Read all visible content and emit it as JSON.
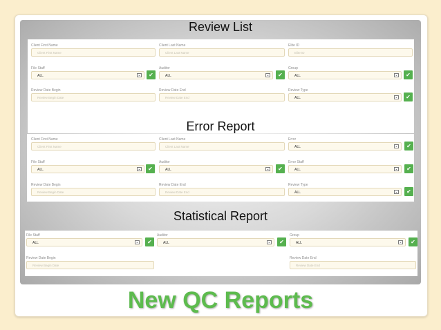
{
  "slide_title": "New QC Reports",
  "review_list": {
    "heading": "Review List",
    "client_first_name": {
      "label": "Client First Name",
      "placeholder": "Client First Name"
    },
    "client_last_name": {
      "label": "Client Last Name",
      "placeholder": "Client Last Name"
    },
    "elite_id": {
      "label": "Elite ID",
      "placeholder": "Elite ID"
    },
    "file_staff": {
      "label": "File Staff",
      "value": "ALL"
    },
    "auditor": {
      "label": "Auditor",
      "value": "ALL"
    },
    "group": {
      "label": "Group",
      "value": "ALL"
    },
    "review_date_begin": {
      "label": "Review Date Begin",
      "placeholder": "Review Begin Date"
    },
    "review_date_end": {
      "label": "Review Date End",
      "placeholder": "Review Date End"
    },
    "review_type": {
      "label": "Review Type",
      "value": "ALL"
    }
  },
  "error_report": {
    "heading": "Error Report",
    "client_first_name": {
      "label": "Client First Name",
      "placeholder": "Client First Name"
    },
    "client_last_name": {
      "label": "Client Last Name",
      "placeholder": "Client Last Name"
    },
    "error": {
      "label": "Error",
      "value": "ALL"
    },
    "file_staff": {
      "label": "File Staff",
      "value": "ALL"
    },
    "auditor": {
      "label": "Auditor",
      "value": "ALL"
    },
    "error_staff": {
      "label": "Error Staff",
      "value": "ALL"
    },
    "review_date_begin": {
      "label": "Review Date Begin",
      "placeholder": "Review Begin Date"
    },
    "review_date_end": {
      "label": "Review Date End",
      "placeholder": "Review Date End"
    },
    "review_type": {
      "label": "Review Type",
      "value": "ALL"
    }
  },
  "statistical_report": {
    "heading": "Statistical Report",
    "file_staff": {
      "label": "File Staff",
      "value": "ALL"
    },
    "auditor": {
      "label": "Auditor",
      "value": "ALL"
    },
    "group": {
      "label": "Group",
      "value": "ALL"
    },
    "review_date_begin": {
      "label": "Review Date Begin",
      "placeholder": "Review Begin Date"
    },
    "review_date_end": {
      "label": "Review Date End",
      "placeholder": "Review Date End"
    }
  },
  "icons": {
    "dropdown": "chevron-down-icon",
    "confirm": "checkmark-icon"
  },
  "colors": {
    "background": "#fbeecd",
    "accent_green": "#5dbb4e",
    "check_button": "#55b04f",
    "field_fill": "#fdf9ec"
  }
}
